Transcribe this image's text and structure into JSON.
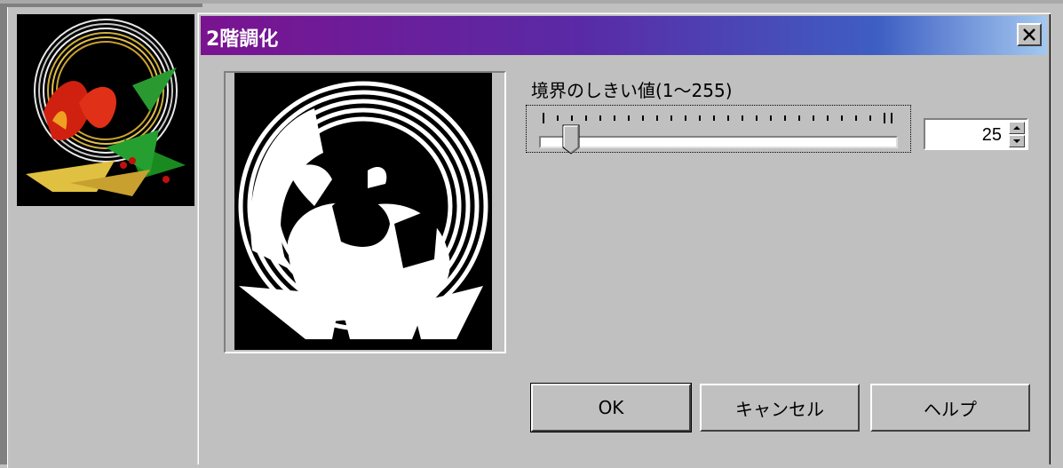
{
  "dialog": {
    "title": "2階調化",
    "close_icon": "close-icon"
  },
  "threshold": {
    "label": "境界のしきい値(1～255)",
    "value": "25",
    "min": 1,
    "max": 255
  },
  "buttons": {
    "ok": "OK",
    "cancel": "キャンセル",
    "help": "ヘルプ"
  },
  "colors": {
    "title_start": "#7a1390",
    "title_end": "#a3c8f0",
    "face": "#c0c0c0"
  }
}
